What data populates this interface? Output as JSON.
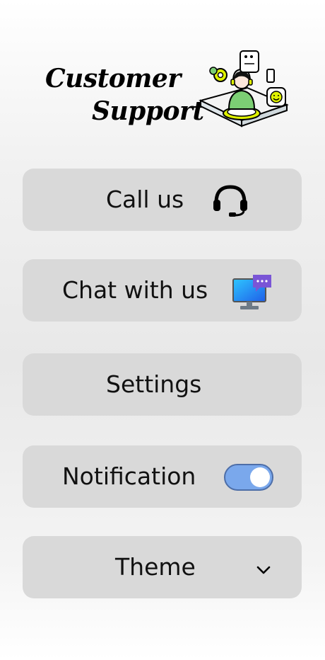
{
  "header": {
    "title_line1": "Customer",
    "title_line2": "Support"
  },
  "menu": {
    "call_label": "Call us",
    "chat_label": "Chat with us",
    "settings_label": "Settings",
    "notification_label": "Notification",
    "notification_enabled": true,
    "theme_label": "Theme"
  },
  "icons": {
    "call": "headset-icon",
    "chat": "computer-chat-icon",
    "theme": "chevron-down-icon",
    "illustration": "support-agent-illustration"
  },
  "colors": {
    "button_bg": "#d9d9d9",
    "toggle_track": "#7aa8ec",
    "toggle_knob": "#ffffff"
  }
}
